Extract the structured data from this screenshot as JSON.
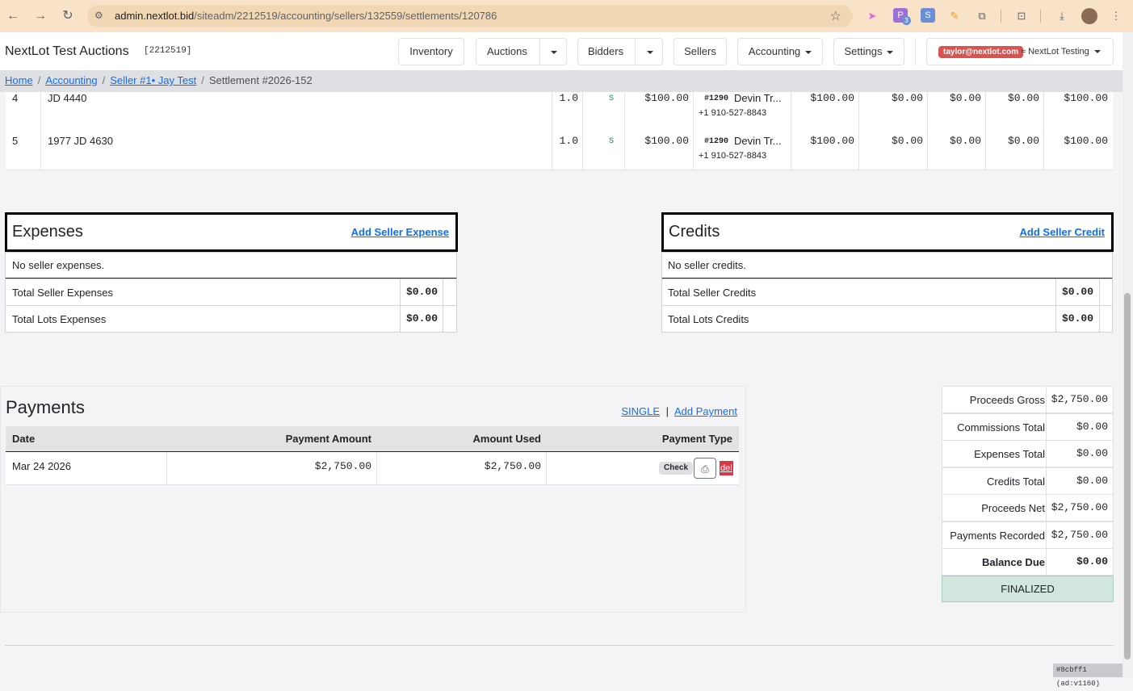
{
  "browser": {
    "url_host": "admin.nextlot.bid",
    "url_path": "/siteadm/2212519/accounting/sellers/132559/settlements/120786",
    "ext_badge_count": "3"
  },
  "header": {
    "site_title": "NextLot Test Auctions",
    "site_code": "[2212519]",
    "nav": {
      "inventory": "Inventory",
      "auctions": "Auctions",
      "bidders": "Bidders",
      "sellers": "Sellers",
      "accounting": "Accounting",
      "settings": "Settings"
    },
    "user_email": "taylor@nextlot.com",
    "account_name": "≈ NextLot Testing"
  },
  "breadcrumb": {
    "home": "Home",
    "accounting": "Accounting",
    "seller": "Seller #1• Jay Test",
    "current": "Settlement #2026-152"
  },
  "lots": [
    {
      "num": "4",
      "title": "JD 4440",
      "qty": "1.0",
      "flag": "S",
      "price": "$100.00",
      "bidder_no": "#1290",
      "bidder_name": "Devin Tr...",
      "bidder_phone": "+1 910-527-8843",
      "gross": "$100.00",
      "c1": "$0.00",
      "c2": "$0.00",
      "c3": "$0.00",
      "net": "$100.00"
    },
    {
      "num": "5",
      "title": "1977 JD 4630",
      "qty": "1.0",
      "flag": "S",
      "price": "$100.00",
      "bidder_no": "#1290",
      "bidder_name": "Devin Tr...",
      "bidder_phone": "+1 910-527-8843",
      "gross": "$100.00",
      "c1": "$0.00",
      "c2": "$0.00",
      "c3": "$0.00",
      "net": "$100.00"
    }
  ],
  "expenses": {
    "title": "Expenses",
    "add_link": "Add Seller Expense",
    "empty": "No seller expenses.",
    "total_seller_label": "Total Seller Expenses",
    "total_seller_value": "$0.00",
    "total_lots_label": "Total Lots Expenses",
    "total_lots_value": "$0.00"
  },
  "credits": {
    "title": "Credits",
    "add_link": "Add Seller Credit",
    "empty": "No seller credits.",
    "total_seller_label": "Total Seller Credits",
    "total_seller_value": "$0.00",
    "total_lots_label": "Total Lots Credits",
    "total_lots_value": "$0.00"
  },
  "payments": {
    "title": "Payments",
    "single_link": "SINGLE",
    "separator": "|",
    "add_link": "Add Payment",
    "columns": {
      "date": "Date",
      "amount": "Payment Amount",
      "used": "Amount Used",
      "type": "Payment Type"
    },
    "rows": [
      {
        "date": "Mar 24 2026",
        "amount": "$2,750.00",
        "used": "$2,750.00",
        "type": "Check",
        "delete": "del"
      }
    ]
  },
  "summary": {
    "rows": [
      {
        "label": "Proceeds Gross",
        "value": "$2,750.00"
      },
      {
        "label": "Commissions Total",
        "value": "$0.00"
      },
      {
        "label": "Expenses Total",
        "value": "$0.00"
      },
      {
        "label": "Credits Total",
        "value": "$0.00"
      },
      {
        "label": "Proceeds Net",
        "value": "$2,750.00"
      },
      {
        "label": "Payments Recorded",
        "value": "$2,750.00"
      },
      {
        "label": "Balance Due",
        "value": "$0.00"
      }
    ],
    "status": "FINALIZED"
  },
  "footer": {
    "build": "#8cbff1 (ad:v1160)"
  },
  "colors": {
    "chrome": "#f9e3c8",
    "link": "#0d6efd",
    "finalized_bg": "#d1e7dd",
    "danger": "#dc3545"
  }
}
